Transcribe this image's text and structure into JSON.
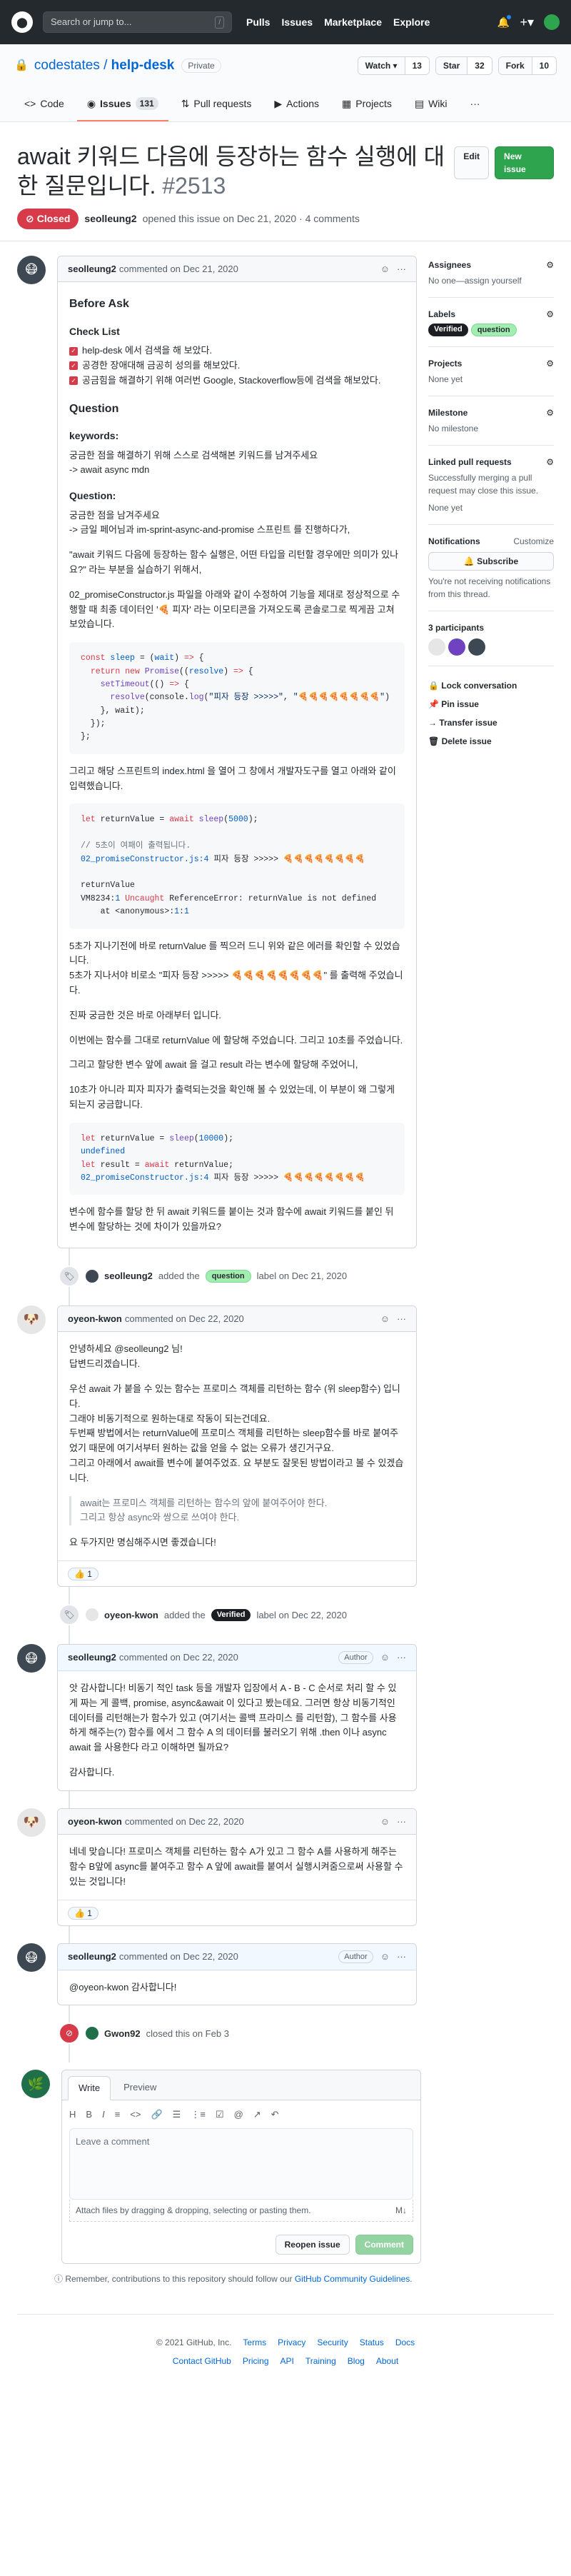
{
  "header": {
    "logo": "⬤",
    "search_placeholder": "Search or jump to...",
    "slash_key": "/",
    "nav": [
      "Pulls",
      "Issues",
      "Marketplace",
      "Explore"
    ]
  },
  "repo": {
    "owner": "codestates",
    "separator": " / ",
    "name": "help-desk",
    "visibility": "Private",
    "watch_label": "Watch ▾",
    "watch_count": "13",
    "star_label": "Star",
    "star_count": "32",
    "fork_label": "Fork",
    "fork_count": "10",
    "tabs": [
      {
        "icon": "<>",
        "label": "Code"
      },
      {
        "icon": "◉",
        "label": "Issues",
        "count": "131"
      },
      {
        "icon": "⇅",
        "label": "Pull requests"
      },
      {
        "icon": "▶",
        "label": "Actions"
      },
      {
        "icon": "▦",
        "label": "Projects"
      },
      {
        "icon": "▤",
        "label": "Wiki"
      }
    ],
    "more": "···"
  },
  "issue": {
    "title": "await 키워드 다음에 등장하는 함수 실행에 대한 질문입니다.",
    "number": "#2513",
    "edit_label": "Edit",
    "new_issue_label": "New issue",
    "state": "Closed",
    "author": "seolleung2",
    "opened_text": "opened this issue on Dec 21, 2020 · 4 comments"
  },
  "comments": {
    "c1": {
      "author": "seolleung2",
      "date": "commented on Dec 21, 2020",
      "h_before": "Before Ask",
      "h_check": "Check List",
      "tasks": [
        "help-desk 에서 검색을 해 보았다.",
        "공경한 장애대해 금공히 성의를 해보았다.",
        "공금힘을 해결하기 위해 여러번 Google, Stackoverflow등에 검색을 해보았다."
      ],
      "h_question": "Question",
      "h_keywords": "keywords:",
      "keywords_text": "궁금한 점을 해결하기 위해 스스로 검색해본 키워드를 남겨주세요",
      "keywords_value": "-> await async mdn",
      "h_question2": "Question:",
      "q_p1a": "궁금한 점을 남겨주세요",
      "q_p1b": "-> 금일 페어님과 im-sprint-async-and-promise 스프린트 를 진행하다가,",
      "q_p2": "\"await 키워드 다음에 등장하는 함수 실행은, 어떤 타입을 리턴할 경우에만 의미가 있나요?\" 라는 부분을 실습하기 위해서,",
      "q_p3": "02_promiseConstructor.js 파일을 아래와 같이 수정하여 기능을 제대로 정상적으로 수행할 때 최종 데이터인 '🍕 피자' 라는 이모티콘을 가져오도록 콘솔로그로 찍게끔 고쳐 보았습니다.",
      "p_after_code1": "그리고 해당 스프린트의 index.html 을 열어 그 창에서 개발자도구를 열고 아래와 같이 입력했습니다.",
      "p_result1": "5초가 지나기전에 바로 returnValue 를 찍으러 드니 위와 같은 에러를 확인할 수 있었습니다.",
      "p_result2": "5초가 지나서야 비로소 \"피자 등장 >>>>> 🍕🍕🍕🍕🍕🍕🍕🍕\" 를 출력해 주었습니다.",
      "p_curious": "진짜 궁금한 것은 바로 아래부터 입니다.",
      "p_this_time": "이번에는 함수를 그대로 returnValue 에 할당해 주었습니다. 그리고 10초를 주었습니다.",
      "p_await": "그리고 할당한 변수 앞에 await 을 걸고 result 라는 변수에 할당해 주었어니,",
      "p_10s": "10초가 아니라 피자 피자가 출력되는것을 확인해 볼 수 있었는데, 이 부분이 왜 그렇게 되는지 궁금합니다.",
      "p_last": "변수에 함수를 할당 한 뒤 await 키워드를 붙이는 것과 함수에 await 키워드를 붙인 뒤 변수에 할당하는 것에 차이가 있을까요?"
    },
    "e1": {
      "actor": "seolleung2",
      "added": "added the",
      "label": "question",
      "suffix": "label on Dec 21, 2020"
    },
    "c2": {
      "author": "oyeon-kwon",
      "date": "commented on Dec 22, 2020",
      "p1": "안녕하세요 @seolleung2 님!",
      "p1b": "답변드리겠습니다.",
      "p2": "우선 await 가 붙을 수 있는 함수는 프로미스 객체를 리턴하는 함수 (위 sleep함수) 입니다.",
      "p2b": "그래야 비동기적으로 원하는대로 작동이 되는건데요.",
      "p2c": "두번째 방법에서는 returnValue에 프로미스 객체를 리턴하는 sleep함수를 바로 붙여주었기 때문에 여기서부터 원하는 값을 얻을 수 없는 오류가 생긴거구요.",
      "p2d": "그리고 아래에서 await를 변수에 붙여주었죠. 요 부분도 잘못된 방법이라고 볼 수 있겠습니다.",
      "quote1": "await는 프로미스 객체를 리턴하는 함수의 앞에 붙여주어야 한다.",
      "quote2": "그리고 항상 async와 쌍으로 쓰여야 한다.",
      "p3": "요 두가지만 명심해주시면 좋겠습니다!",
      "reaction": "👍 1"
    },
    "e2": {
      "actor": "oyeon-kwon",
      "added": "added the",
      "label": "Verified",
      "suffix": "label on Dec 22, 2020"
    },
    "c3": {
      "author": "seolleung2",
      "date": "commented on Dec 22, 2020",
      "badge": "Author",
      "p1": "앗 감사합니다! 비동기 적인 task 등을 개발자 입장에서 A - B - C 순서로 처리 할 수 있게 짜는 게 콜백, promise, async&await 이 있다고 봤는데요. 그러면 항상 비동기적인 데이터를 리턴해는가 함수가 있고 (여기서는 콜백 프라미스 를 리턴함), 그 함수를 사용하게 해주는(?) 함수를 에서 그 함수 A 의 데이터를 불러오기 위해 .then 이나 async await 을 사용한다 라고 이해하면 될까요?",
      "p2": "감사합니다."
    },
    "c4": {
      "author": "oyeon-kwon",
      "date": "commented on Dec 22, 2020",
      "p1": "네네 맞습니다! 프로미스 객체를 리턴하는 함수 A가 있고 그 함수 A를 사용하게 해주는 함수 B앞에 async를 붙여주고 함수 A 앞에 await를 붙여서 실행시켜줌으로써 사용할 수 있는 것입니다!",
      "reaction": "👍 1"
    },
    "c5": {
      "author": "seolleung2",
      "date": "commented on Dec 22, 2020",
      "badge": "Author",
      "p1": "@oyeon-kwon 감사합니다!"
    },
    "e3": {
      "actor": "Gwon92",
      "text": "closed this on Feb 3"
    }
  },
  "sidebar": {
    "assignees_title": "Assignees",
    "assignees_value": "No one—assign yourself",
    "labels_title": "Labels",
    "label1": "Verified",
    "label2": "question",
    "projects_title": "Projects",
    "projects_value": "None yet",
    "milestone_title": "Milestone",
    "milestone_value": "No milestone",
    "linked_title": "Linked pull requests",
    "linked_value": "Successfully merging a pull request may close this issue.",
    "linked_value2": "None yet",
    "notif_title": "Notifications",
    "notif_customize": "Customize",
    "subscribe_label": "🔔 Subscribe",
    "notif_text": "You're not receiving notifications from this thread.",
    "participants_title": "3 participants",
    "lock": "Lock conversation",
    "pin": "Pin issue",
    "transfer": "Transfer issue",
    "delete": "Delete issue"
  },
  "composer": {
    "tab_write": "Write",
    "tab_preview": "Preview",
    "toolbar": [
      "H",
      "B",
      "I",
      "≡",
      "<>",
      "🔗",
      "☰",
      "⋮≡",
      "☑",
      "@",
      "↗",
      "↶"
    ],
    "placeholder": "Leave a comment",
    "attach": "Attach files by dragging & dropping, selecting or pasting them.",
    "md": "M↓",
    "reopen": "Reopen issue",
    "comment": "Comment",
    "remember_pre": "Remember, contributions to this repository should follow our",
    "remember_link": "GitHub Community Guidelines",
    "remember_post": "."
  },
  "footer": {
    "copyright": "© 2021 GitHub, Inc.",
    "row1": [
      "Terms",
      "Privacy",
      "Security",
      "Status",
      "Docs"
    ],
    "row2": [
      "Contact GitHub",
      "Pricing",
      "API",
      "Training",
      "Blog",
      "About"
    ]
  }
}
